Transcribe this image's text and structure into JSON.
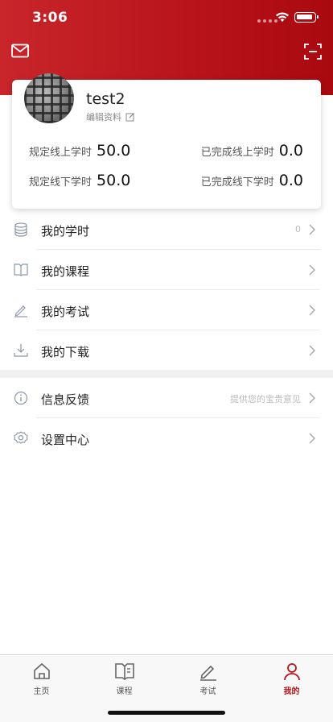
{
  "status_bar": {
    "time": "3:06"
  },
  "header": {
    "mail_icon": "mail-icon",
    "scan_icon": "scan-icon",
    "accent_color": "#c8262b"
  },
  "profile": {
    "username": "test2",
    "edit_label": "编辑资料",
    "stats": [
      {
        "label": "规定线上学时",
        "value": "50.0"
      },
      {
        "label": "已完成线上学时",
        "value": "0.0"
      },
      {
        "label": "规定线下学时",
        "value": "50.0"
      },
      {
        "label": "已完成线下学时",
        "value": "0.0"
      }
    ]
  },
  "menu": {
    "group1": [
      {
        "label": "我的学时",
        "aside": "0",
        "icon": "database-icon"
      },
      {
        "label": "我的课程",
        "aside": "",
        "icon": "book-icon"
      },
      {
        "label": "我的考试",
        "aside": "",
        "icon": "pen-icon"
      },
      {
        "label": "我的下载",
        "aside": "",
        "icon": "download-icon"
      }
    ],
    "group2": [
      {
        "label": "信息反馈",
        "aside": "提供您的宝贵意见",
        "icon": "info-icon"
      },
      {
        "label": "设置中心",
        "aside": "",
        "icon": "settings-icon"
      }
    ]
  },
  "tabs": [
    {
      "label": "主页",
      "icon": "home-icon",
      "active": false
    },
    {
      "label": "课程",
      "icon": "book-icon",
      "active": false
    },
    {
      "label": "考试",
      "icon": "exam-icon",
      "active": false
    },
    {
      "label": "我的",
      "icon": "user-icon",
      "active": true
    }
  ],
  "active_color": "#b8141c"
}
